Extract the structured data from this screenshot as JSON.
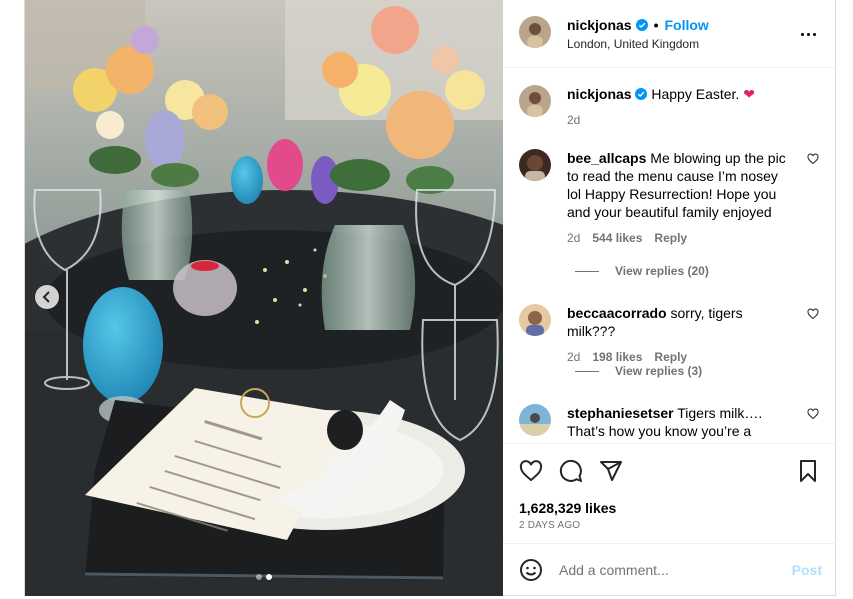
{
  "post": {
    "author": "nickjonas",
    "follow_label": "Follow",
    "separator": "•",
    "location": "London, United Kingdom",
    "caption": {
      "username": "nickjonas",
      "text": "Happy Easter.",
      "emoji": "❤️",
      "time": "2d"
    },
    "likes": "1,628,329 likes",
    "timestamp": "2 DAYS AGO",
    "carousel": {
      "slides": 2,
      "active": 2
    }
  },
  "comments": [
    {
      "username": "bee_allcaps",
      "text": "Me blowing up the pic to read the menu cause I’m nosey lol Happy Resurrection! Hope you and your beautiful family enjoyed",
      "time": "2d",
      "likes": "544 likes",
      "reply_label": "Reply",
      "view_replies": "View replies (20)"
    },
    {
      "username": "beccaacorrado",
      "text": "sorry, tigers milk???",
      "time": "2d",
      "likes": "198 likes",
      "reply_label": "Reply",
      "view_replies": "View replies (3)"
    },
    {
      "username": "stephaniesetser",
      "text": "Tigers milk…. That’s how you know you’re a rockstar."
    }
  ],
  "add_comment": {
    "placeholder": "Add a comment...",
    "post_label": "Post"
  },
  "colors": {
    "accent": "#0095f6",
    "post_disabled": "#b2dffc",
    "heart": "#ed4956",
    "muted": "#737373"
  },
  "icons": [
    "chevron-left-icon",
    "more-icon",
    "verified-icon",
    "heart-icon",
    "comment-icon",
    "share-icon",
    "bookmark-icon",
    "emoji-icon"
  ]
}
